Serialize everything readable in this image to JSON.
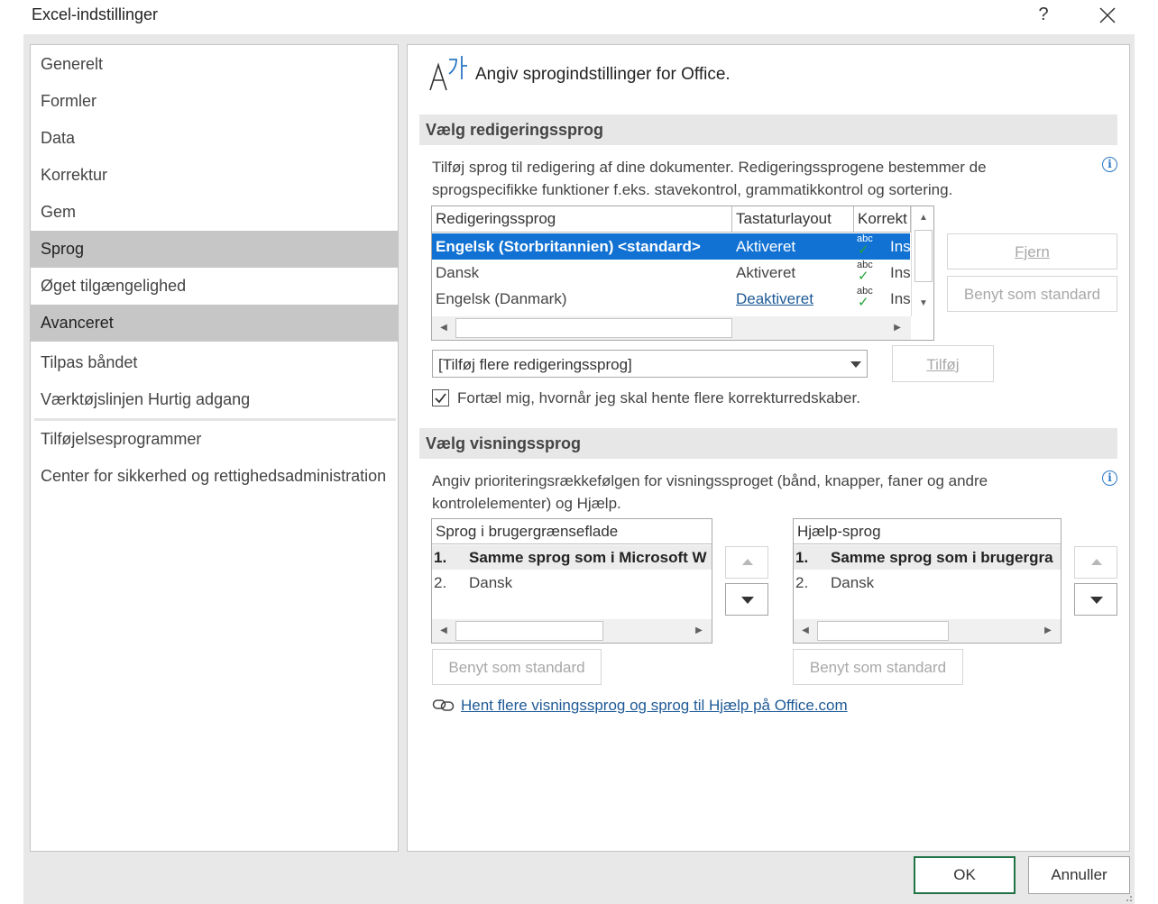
{
  "window": {
    "title": "Excel-indstillinger",
    "help_label": "?",
    "close_icon": "close-icon"
  },
  "sidebar": {
    "items": [
      {
        "label": "Generelt",
        "selected": false
      },
      {
        "label": "Formler",
        "selected": false
      },
      {
        "label": "Data",
        "selected": false
      },
      {
        "label": "Korrektur",
        "selected": false
      },
      {
        "label": "Gem",
        "selected": false
      },
      {
        "label": "Sprog",
        "selected": true
      },
      {
        "label": "Øget tilgængelighed",
        "selected": false
      },
      {
        "label": "Avanceret",
        "selected": true
      },
      {
        "label": "Tilpas båndet",
        "selected": false
      },
      {
        "label": "Værktøjslinjen Hurtig adgang",
        "selected": false
      },
      {
        "label": "Tilføjelsesprogrammer",
        "selected": false
      },
      {
        "label": "Center for sikkerhed og rettighedsadministration",
        "selected": false
      }
    ]
  },
  "header": {
    "icon": "language-icon",
    "text": "Angiv sprogindstillinger for Office."
  },
  "editing": {
    "section_title": "Vælg redigeringssprog",
    "description": "Tilføj sprog til redigering af dine dokumenter. Redigeringssprogene bestemmer de sprogspecifikke funktioner f.eks. stavekontrol, grammatikkontrol og sortering.",
    "columns": [
      "Redigeringssprog",
      "Tastaturlayout",
      "Korrekt"
    ],
    "rows": [
      {
        "language": "Engelsk (Storbritannien) <standard>",
        "keyboard": "Aktiveret",
        "proofing_icon": "abc",
        "proofing_check": "✓",
        "proofing": "Ins",
        "selected": true
      },
      {
        "language": "Dansk",
        "keyboard": "Aktiveret",
        "proofing_icon": "abc",
        "proofing_check": "✓",
        "proofing": "Ins",
        "selected": false
      },
      {
        "language": "Engelsk (Danmark)",
        "keyboard": "Deaktiveret",
        "proofing_icon": "abc",
        "proofing_check": "✓",
        "proofing": "Ins",
        "selected": false
      }
    ],
    "remove_button": "Fjern",
    "set_default_button": "Benyt som standard",
    "add_dropdown_value": "[Tilføj flere redigeringssprog]",
    "add_button": "Tilføj",
    "notify_checkbox_label": "Fortæl mig, hvornår jeg skal hente flere korrekturredskaber.",
    "notify_checked": true
  },
  "display": {
    "section_title": "Vælg visningssprog",
    "description": "Angiv prioriteringsrækkefølgen for visningssproget (bånd, knapper, faner og andre kontrolelementer) og Hjælp.",
    "ui_list": {
      "header": "Sprog i brugergrænseflade",
      "rows": [
        {
          "num": "1.",
          "text": "Samme sprog som i Microsoft W"
        },
        {
          "num": "2.",
          "text": "Dansk"
        }
      ],
      "set_default_button": "Benyt som standard"
    },
    "help_list": {
      "header": "Hjælp-sprog",
      "rows": [
        {
          "num": "1.",
          "text": "Samme sprog som i brugergra"
        },
        {
          "num": "2.",
          "text": "Dansk"
        }
      ],
      "set_default_button": "Benyt som standard"
    },
    "office_link": "Hent flere visningssprog og sprog til Hjælp på Office.com"
  },
  "footer": {
    "ok_button": "OK",
    "cancel_button": "Annuller"
  },
  "colors": {
    "selection_blue": "#1172d3",
    "nav_selected": "#c6c6c6",
    "ok_border": "#217346",
    "link": "#1f5a96",
    "check_green": "#24a337"
  }
}
